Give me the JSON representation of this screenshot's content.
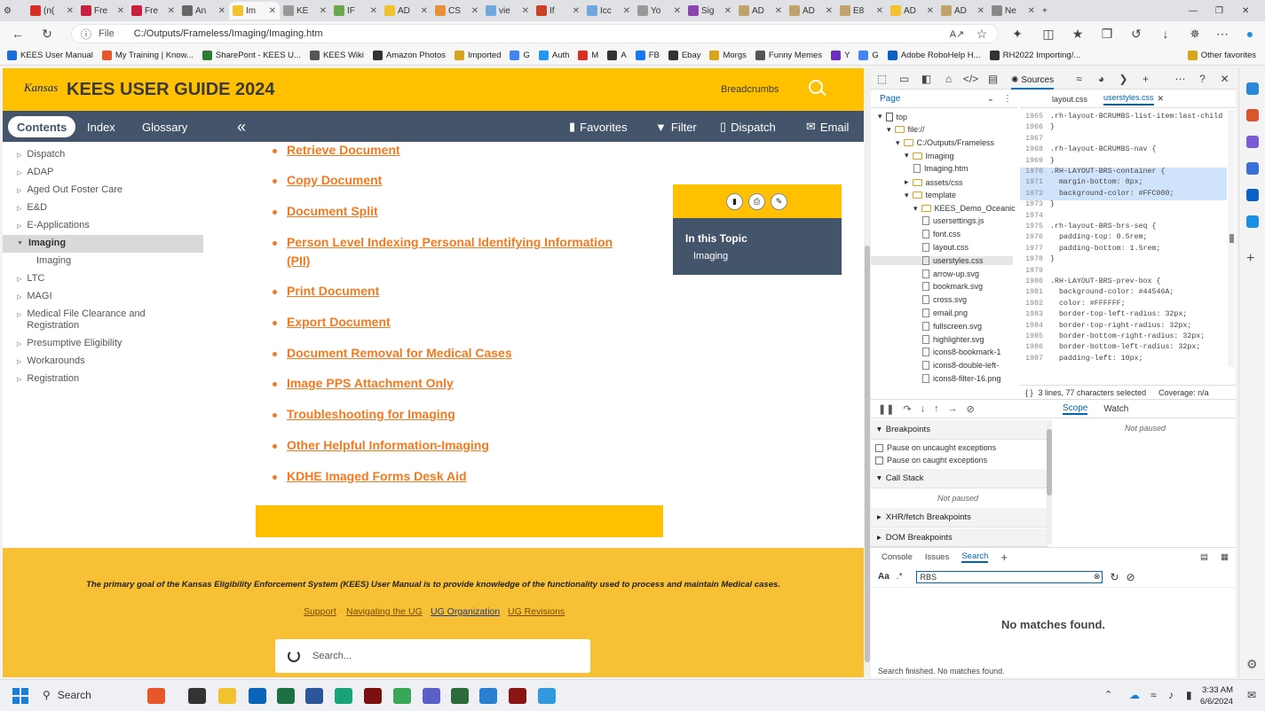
{
  "browser": {
    "tabs": [
      "(n(",
      "Fre",
      "Fre",
      "An",
      "Im",
      "KE",
      "IF",
      "AD",
      "CS",
      "vie",
      "If",
      "Icc",
      "Yo",
      "Sig",
      "AD",
      "AD",
      "E8",
      "AD",
      "AD",
      "Ne"
    ],
    "active_tab_index": 4,
    "url_prefix": "File",
    "url": "C:/Outputs/Frameless/Imaging/Imaging.htm",
    "bookmarks": [
      "KEES User Manual",
      "My Training | Know...",
      "SharePont - KEES U...",
      "KEES Wiki",
      "Amazon Photos",
      "Imported",
      "G",
      "Auth",
      "M",
      "A",
      "FB",
      "Ebay",
      "Morgs",
      "Funny Memes",
      "Y",
      "G",
      "Adobe RoboHelp H...",
      "RH2022 Importing/...",
      "Other favorites"
    ]
  },
  "site": {
    "logo": "Kansas",
    "title": "KEES USER GUIDE 2024",
    "breadcrumbs": "Breadcrumbs",
    "nav": {
      "contents": "Contents",
      "index": "Index",
      "glossary": "Glossary",
      "favorites": "Favorites",
      "filter": "Filter",
      "dispatch": "Dispatch",
      "email": "Email"
    },
    "sidebar": [
      {
        "label": "Dispatch"
      },
      {
        "label": "ADAP"
      },
      {
        "label": "Aged Out Foster Care"
      },
      {
        "label": "E&D"
      },
      {
        "label": "E-Applications"
      },
      {
        "label": "Imaging",
        "expanded": true
      },
      {
        "label": "Imaging",
        "child": true
      },
      {
        "label": "LTC"
      },
      {
        "label": "MAGI"
      },
      {
        "label": "Medical File Clearance and Registration"
      },
      {
        "label": "Presumptive Eligibility"
      },
      {
        "label": "Workarounds"
      },
      {
        "label": "Registration"
      }
    ],
    "links": [
      "Retrieve Document",
      "Copy Document",
      "Document Split",
      "Person Level Indexing Personal Identifying Information (PII)",
      "Print Document",
      "Export Document",
      "Document Removal for Medical Cases",
      "Image PPS Attachment Only",
      "Troubleshooting for Imaging",
      "Other Helpful Information-Imaging",
      "KDHE Imaged Forms Desk Aid"
    ],
    "topic": {
      "heading": "In this Topic",
      "item": "Imaging"
    },
    "footer": {
      "text": "The primary goal of the Kansas Eligibility Enforcement System (KEES) User Manual is to provide knowledge of the functionality used to process and maintain Medical cases.",
      "links": [
        "Support",
        "Navigating the UG",
        "UG Organization",
        "UG Revisions"
      ],
      "search_placeholder": "Search..."
    }
  },
  "devtools": {
    "sources_tab": "Sources",
    "page_label": "Page",
    "file_tabs": [
      "layout.css",
      "userstyles.css"
    ],
    "tree": [
      {
        "label": "top",
        "type": "root",
        "indent": 0
      },
      {
        "label": "file://",
        "type": "cloud",
        "indent": 1
      },
      {
        "label": "C:/Outputs/Frameless",
        "type": "folder",
        "indent": 2
      },
      {
        "label": "Imaging",
        "type": "folder",
        "indent": 3
      },
      {
        "label": "Imaging.htm",
        "type": "file",
        "indent": 4
      },
      {
        "label": "assets/css",
        "type": "folder",
        "indent": 3
      },
      {
        "label": "template",
        "type": "folder",
        "indent": 3
      },
      {
        "label": "KEES_Demo_Oceanic",
        "type": "folder",
        "indent": 4
      },
      {
        "label": "usersettings.js",
        "type": "file",
        "indent": 5
      },
      {
        "label": "font.css",
        "type": "file",
        "indent": 5
      },
      {
        "label": "layout.css",
        "type": "file",
        "indent": 5
      },
      {
        "label": "userstyles.css",
        "type": "file",
        "indent": 5,
        "selected": true
      },
      {
        "label": "arrow-up.svg",
        "type": "file",
        "indent": 5
      },
      {
        "label": "bookmark.svg",
        "type": "file",
        "indent": 5
      },
      {
        "label": "cross.svg",
        "type": "file",
        "indent": 5
      },
      {
        "label": "email.png",
        "type": "file",
        "indent": 5
      },
      {
        "label": "fullscreen.svg",
        "type": "file",
        "indent": 5
      },
      {
        "label": "highlighter.svg",
        "type": "file",
        "indent": 5
      },
      {
        "label": "icons8-bookmark-1",
        "type": "file",
        "indent": 5
      },
      {
        "label": "icons8-double-left-",
        "type": "file",
        "indent": 5
      },
      {
        "label": "icons8-filter-16.png",
        "type": "file",
        "indent": 5
      }
    ],
    "code": [
      {
        "n": "1965",
        "t": ".rh-layout-BCRUMBS-list-item:last-child"
      },
      {
        "n": "1966",
        "t": "}"
      },
      {
        "n": "1967",
        "t": ""
      },
      {
        "n": "1968",
        "t": ".rh-layout-BCRUMBS-nav {"
      },
      {
        "n": "1969",
        "t": "}"
      },
      {
        "n": "1970",
        "t": ".RH-LAYOUT-BRS-container {",
        "hl": true
      },
      {
        "n": "1971",
        "t": "  margin-bottom: 8px;",
        "hl": true
      },
      {
        "n": "1972",
        "t": "  background-color: #FFC000;",
        "hl": true
      },
      {
        "n": "1973",
        "t": "}"
      },
      {
        "n": "1974",
        "t": ""
      },
      {
        "n": "1975",
        "t": ".rh-layout-BRS-brs-seq {"
      },
      {
        "n": "1976",
        "t": "  padding-top: 0.5rem;"
      },
      {
        "n": "1977",
        "t": "  padding-bottom: 1.5rem;"
      },
      {
        "n": "1978",
        "t": "}"
      },
      {
        "n": "1979",
        "t": ""
      },
      {
        "n": "1980",
        "t": ".RH-LAYOUT-BRS-prev-box {"
      },
      {
        "n": "1981",
        "t": "  background-color: #44546A;"
      },
      {
        "n": "1982",
        "t": "  color: #FFFFFF;"
      },
      {
        "n": "1983",
        "t": "  border-top-left-radius: 32px;"
      },
      {
        "n": "1984",
        "t": "  border-top-right-radius: 32px;"
      },
      {
        "n": "1985",
        "t": "  border-bottom-right-radius: 32px;"
      },
      {
        "n": "1986",
        "t": "  border-bottom-left-radius: 32px;"
      },
      {
        "n": "1987",
        "t": "  padding-left: 10px;"
      }
    ],
    "status": "3 lines, 77 characters selected",
    "coverage": "Coverage: n/a",
    "scope_tab": "Scope",
    "watch_tab": "Watch",
    "not_paused": "Not paused",
    "breakpoints": "Breakpoints",
    "pause_uncaught": "Pause on uncaught exceptions",
    "pause_caught": "Pause on caught exceptions",
    "call_stack": "Call Stack",
    "xhr": "XHR/fetch Breakpoints",
    "dom": "DOM Breakpoints",
    "bottom_tabs": [
      "Console",
      "Issues",
      "Search"
    ],
    "search_value": "RBS",
    "aa": "Aa",
    "regex": ".*",
    "no_matches": "No matches found.",
    "search_finished": "Search finished.  No matches found."
  },
  "taskbar": {
    "search": "Search",
    "time": "3:33 AM",
    "date": "6/6/2024"
  }
}
